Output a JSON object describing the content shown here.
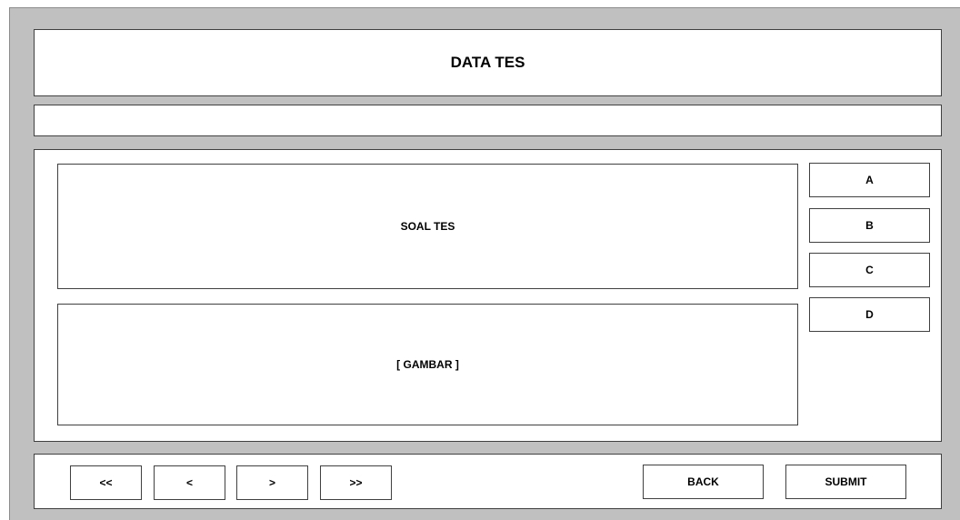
{
  "header": {
    "title": "DATA TES"
  },
  "info_bar": {
    "text": ""
  },
  "question": {
    "text": "SOAL TES",
    "image_placeholder": "[ GAMBAR ]"
  },
  "options": [
    {
      "label": "A"
    },
    {
      "label": "B"
    },
    {
      "label": "C"
    },
    {
      "label": "D"
    }
  ],
  "navigation": {
    "first_label": "<<",
    "prev_label": "<",
    "next_label": ">",
    "last_label": ">>",
    "back_label": "BACK",
    "submit_label": "SUBMIT"
  }
}
